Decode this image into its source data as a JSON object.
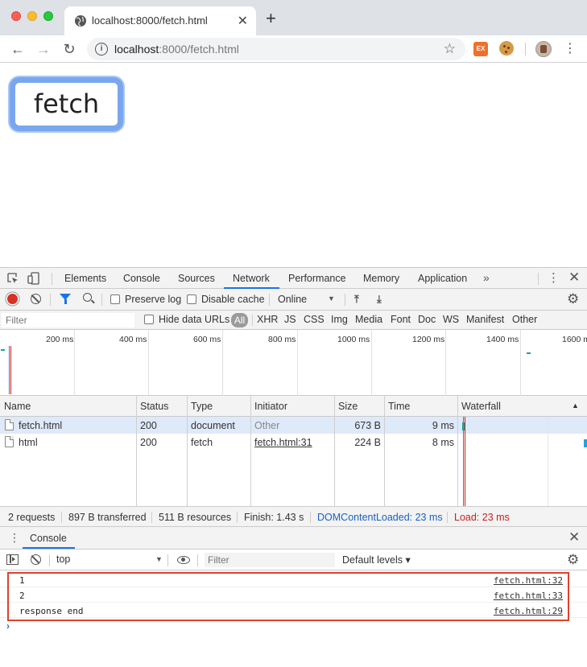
{
  "browser": {
    "tab_title": "localhost:8000/fetch.html",
    "tab_close": "✕",
    "new_tab": "+",
    "url_host": "localhost",
    "url_rest": ":8000/fetch.html",
    "ext_label": "EX"
  },
  "page": {
    "button_label": "fetch"
  },
  "devtools": {
    "tabs": [
      "Elements",
      "Console",
      "Sources",
      "Network",
      "Performance",
      "Memory",
      "Application"
    ],
    "active_tab": "Network",
    "more": "»",
    "close": "✕"
  },
  "network_toolbar": {
    "preserve_log": "Preserve log",
    "disable_cache": "Disable cache",
    "throttle": "Online"
  },
  "filter_bar": {
    "placeholder": "Filter",
    "hide_data_urls": "Hide data URLs",
    "all": "All",
    "types": [
      "XHR",
      "JS",
      "CSS",
      "Img",
      "Media",
      "Font",
      "Doc",
      "WS",
      "Manifest",
      "Other"
    ]
  },
  "overview": {
    "ticks": [
      "200 ms",
      "400 ms",
      "600 ms",
      "800 ms",
      "1000 ms",
      "1200 ms",
      "1400 ms",
      "1600 ms"
    ]
  },
  "grid": {
    "columns": [
      "Name",
      "Status",
      "Type",
      "Initiator",
      "Size",
      "Time",
      "Waterfall"
    ],
    "rows": [
      {
        "name": "fetch.html",
        "status": "200",
        "type": "document",
        "initiator": "Other",
        "size": "673 B",
        "time": "9 ms"
      },
      {
        "name": "html",
        "status": "200",
        "type": "fetch",
        "initiator": "fetch.html:31",
        "size": "224 B",
        "time": "8 ms"
      }
    ]
  },
  "summary": {
    "requests": "2 requests",
    "transferred": "897 B transferred",
    "resources": "511 B resources",
    "finish": "Finish: 1.43 s",
    "dcl": "DOMContentLoaded: 23 ms",
    "load": "Load: 23 ms"
  },
  "drawer": {
    "tab": "Console",
    "close": "✕"
  },
  "console_bar": {
    "context": "top",
    "filter_placeholder": "Filter",
    "levels": "Default levels ▾"
  },
  "console_logs": [
    {
      "msg": "1",
      "src": "fetch.html:32"
    },
    {
      "msg": "2",
      "src": "fetch.html:33"
    },
    {
      "msg": "response end",
      "src": "fetch.html:29"
    }
  ],
  "console_prompt": "›",
  "colors": {
    "accent": "#1a73e8",
    "record": "#d93025",
    "dcl": "#1a5fc4",
    "load": "#c5221f",
    "highlight": "#e0412a"
  }
}
